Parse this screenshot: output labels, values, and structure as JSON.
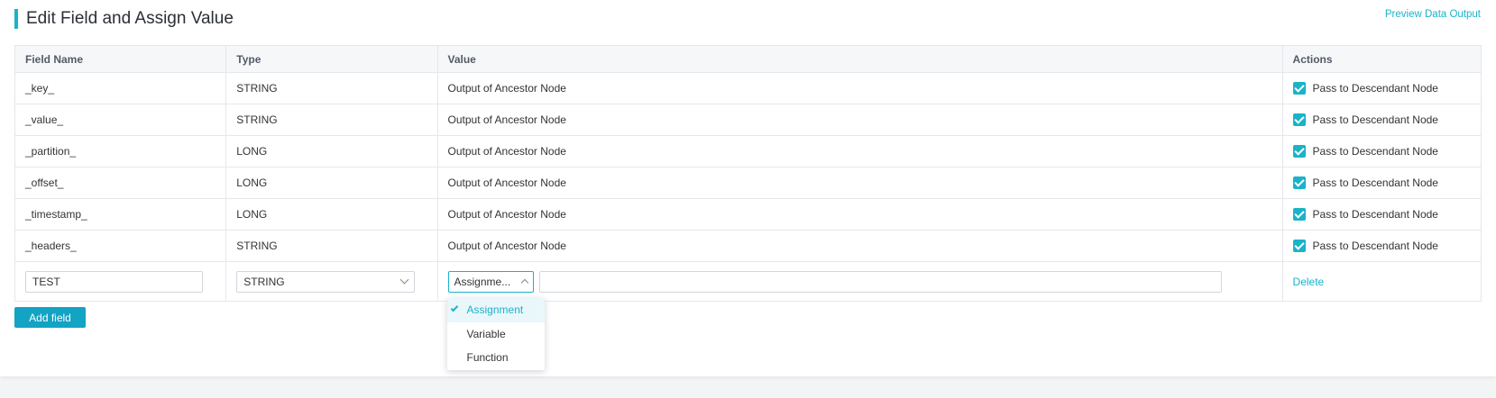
{
  "header": {
    "title": "Edit Field and Assign Value",
    "preview_link": "Preview Data Output"
  },
  "table": {
    "columns": [
      "Field Name",
      "Type",
      "Value",
      "Actions"
    ],
    "rows": [
      {
        "field": "_key_",
        "type": "STRING",
        "value": "Output of Ancestor Node",
        "action": "Pass to Descendant Node",
        "checked": true
      },
      {
        "field": "_value_",
        "type": "STRING",
        "value": "Output of Ancestor Node",
        "action": "Pass to Descendant Node",
        "checked": true
      },
      {
        "field": "_partition_",
        "type": "LONG",
        "value": "Output of Ancestor Node",
        "action": "Pass to Descendant Node",
        "checked": true
      },
      {
        "field": "_offset_",
        "type": "LONG",
        "value": "Output of Ancestor Node",
        "action": "Pass to Descendant Node",
        "checked": true
      },
      {
        "field": "_timestamp_",
        "type": "LONG",
        "value": "Output of Ancestor Node",
        "action": "Pass to Descendant Node",
        "checked": true
      },
      {
        "field": "_headers_",
        "type": "STRING",
        "value": "Output of Ancestor Node",
        "action": "Pass to Descendant Node",
        "checked": true
      }
    ],
    "new_row": {
      "field_name_value": "TEST",
      "type_selected": "STRING",
      "mode_selected": "Assignme...",
      "value_input": "",
      "delete_label": "Delete"
    }
  },
  "mode_dropdown": {
    "options": [
      "Assignment",
      "Variable",
      "Function"
    ],
    "selected": "Assignment"
  },
  "buttons": {
    "add_field": "Add field"
  },
  "colors": {
    "accent": "#1ab3c9",
    "button": "#13a3c3"
  }
}
